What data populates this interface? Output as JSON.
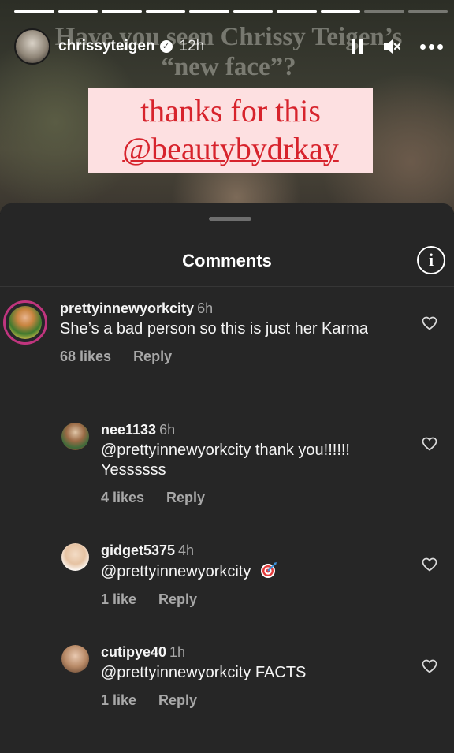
{
  "story": {
    "progress_segments": 10,
    "progress_done": 8,
    "headline": "Have you seen Chrissy Teigen’s “new face”?",
    "sticker_line1": "thanks for this",
    "sticker_line2": "@beautybydrkay",
    "sticker_color": "#d7232c",
    "sticker_bg": "#fde0e1"
  },
  "header": {
    "username": "chrissyteigen",
    "verified_icon": "verified-badge-icon",
    "time": "12h",
    "pause_icon": "pause-icon",
    "mute_icon": "speaker-muted-icon",
    "more_icon": "more-horizontal-icon"
  },
  "sheet": {
    "title": "Comments",
    "info_icon": "info-icon",
    "info_glyph": "i"
  },
  "comments": [
    {
      "username": "prettyinnewyorkcity",
      "time": "6h",
      "text": "She’s a bad person so this is just her Karma",
      "likes": "68 likes",
      "reply": "Reply"
    },
    {
      "username": "nee1133",
      "time": "6h",
      "text": "@prettyinnewyorkcity thank you!!!!!! Yessssss",
      "likes": "4 likes",
      "reply": "Reply"
    },
    {
      "username": "gidget5375",
      "time": "4h",
      "text": "@prettyinnewyorkcity",
      "emoji_icon": "direct-hit-dart-icon",
      "likes": "1 like",
      "reply": "Reply"
    },
    {
      "username": "cutipye40",
      "time": "1h",
      "text": "@prettyinnewyorkcity FACTS",
      "likes": "1 like",
      "reply": "Reply"
    }
  ]
}
